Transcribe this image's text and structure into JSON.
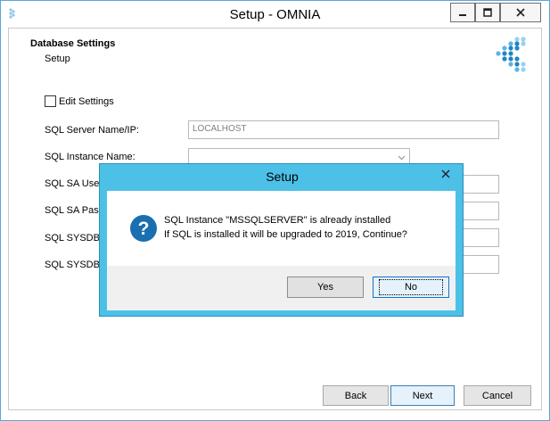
{
  "window": {
    "title": "Setup - OMNIA"
  },
  "header": {
    "heading": "Database Settings",
    "subheading": "Setup"
  },
  "form": {
    "edit_settings_label": "Edit Settings",
    "fields": [
      {
        "label": "SQL Server Name/IP:",
        "value": "LOCALHOST"
      },
      {
        "label": "SQL Instance Name:",
        "value": ""
      },
      {
        "label": "SQL SA Userna",
        "value": ""
      },
      {
        "label": "SQL SA Passw",
        "value": ""
      },
      {
        "label": "SQL SYSDBA",
        "value": ""
      },
      {
        "label": "SQL SYSDBA",
        "value": ""
      }
    ]
  },
  "footer": {
    "back_label": "Back",
    "next_label": "Next",
    "cancel_label": "Cancel"
  },
  "dialog": {
    "title": "Setup",
    "line1": "SQL Instance \"MSSQLSERVER\" is already installed",
    "line2": "If SQL is installed it will be upgraded to 2019, Continue?",
    "yes_label": "Yes",
    "no_label": "No",
    "icon": "question-icon"
  },
  "colors": {
    "dialog_border": "#4dc0e8",
    "accent": "#1a6fb0"
  }
}
